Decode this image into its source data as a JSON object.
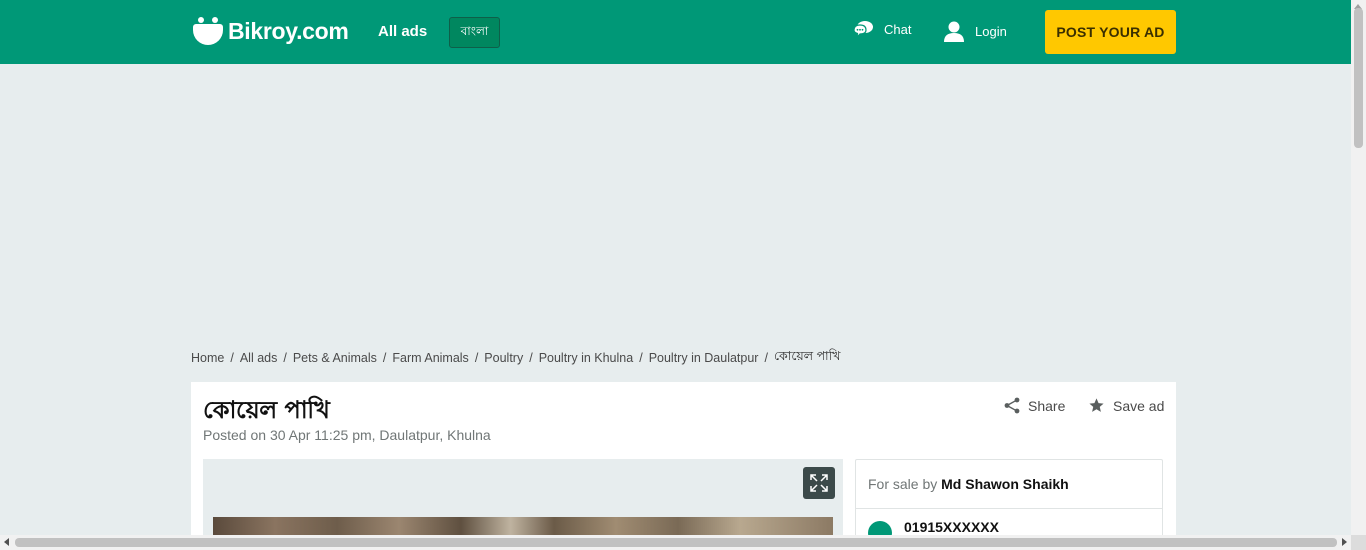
{
  "header": {
    "logo_text": "Bikroy.com",
    "all_ads_label": "All ads",
    "language_label": "বাংলা",
    "chat_label": "Chat",
    "login_label": "Login",
    "post_ad_label": "POST YOUR AD",
    "brand_color": "#009877",
    "post_button_color": "#ffc800"
  },
  "breadcrumb": [
    "Home",
    "All ads",
    "Pets & Animals",
    "Farm Animals",
    "Poultry",
    "Poultry in Khulna",
    "Poultry in Daulatpur",
    "কোয়েল পাখি"
  ],
  "ad": {
    "title": "কোয়েল পাখি",
    "posted_text": "Posted on 30 Apr 11:25 pm, Daulatpur, Khulna",
    "share_label": "Share",
    "save_label": "Save ad"
  },
  "seller": {
    "for_sale_by_label": "For sale by",
    "name": "Md Shawon Shaikh",
    "phone": "01915XXXXXX"
  },
  "icons": {
    "chat": "chat-bubbles-icon",
    "login": "user-icon",
    "share": "share-icon",
    "save": "star-icon",
    "expand": "expand-icon",
    "phone": "phone-icon"
  }
}
